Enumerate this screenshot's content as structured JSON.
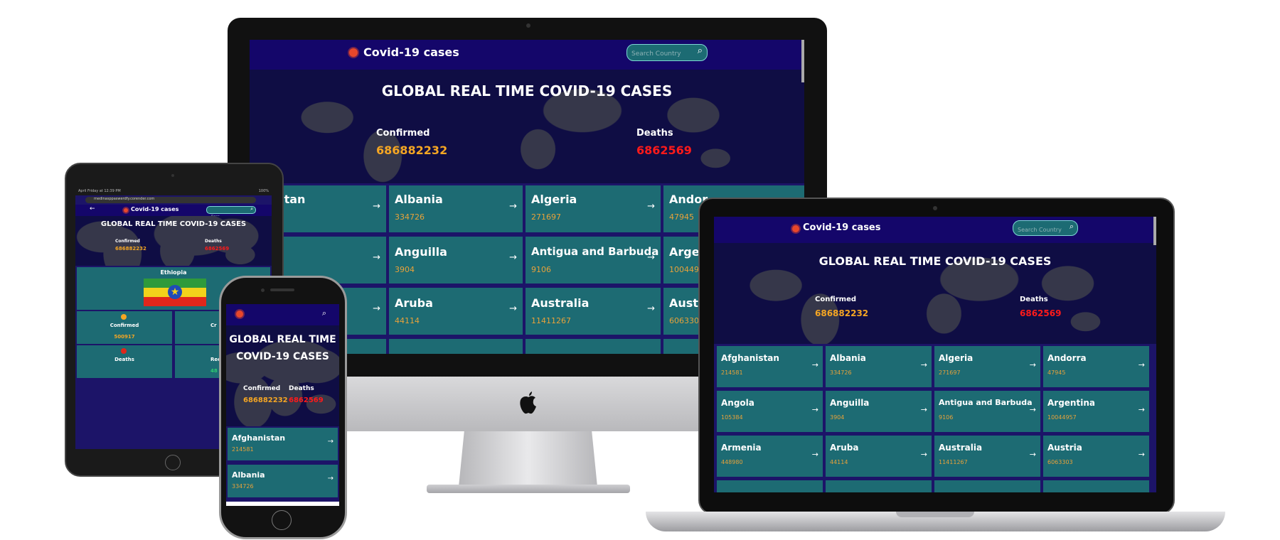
{
  "app": {
    "brand": "Covid-19 cases",
    "search_placeholder": "Search Country",
    "hero_title": "GLOBAL REAL TIME COVID-19 CASES",
    "phone_hero_title_line1": "GLOBAL REAL TIME",
    "phone_hero_title_line2": "COVID-19 CASES",
    "confirmed_label": "Confirmed",
    "deaths_label": "Deaths",
    "confirmed_value": "686882232",
    "deaths_value": "6862569",
    "arrow_glyph": "→",
    "search_glyph": "⌕",
    "icons": {
      "logo": "virus-logo-icon",
      "search": "search-icon",
      "arrow": "arrow-right-icon"
    },
    "colors": {
      "nav": "#14066a",
      "card": "#1d6b73",
      "confirmed": "#f5a623",
      "deaths": "#ff1a1a"
    }
  },
  "countries": [
    {
      "name": "Afghanistan",
      "value": "214581"
    },
    {
      "name": "Albania",
      "value": "334726"
    },
    {
      "name": "Algeria",
      "value": "271697"
    },
    {
      "name": "Andorra",
      "value": "47945"
    },
    {
      "name": "Angola",
      "value": "105384"
    },
    {
      "name": "Anguilla",
      "value": "3904"
    },
    {
      "name": "Antigua and Barbuda",
      "value": "9106"
    },
    {
      "name": "Argentina",
      "value": "10044957"
    },
    {
      "name": "Armenia",
      "value": "448980"
    },
    {
      "name": "Aruba",
      "value": "44114"
    },
    {
      "name": "Australia",
      "value": "11411267"
    },
    {
      "name": "Austria",
      "value": "6063303"
    }
  ],
  "imac_visible": {
    "row1": [
      {
        "name": "hanistan"
      },
      {
        "name": "Albania",
        "value": "334726"
      },
      {
        "name": "Algeria",
        "value": "271697"
      },
      {
        "name": "Andor",
        "value": "47945"
      }
    ],
    "row2": [
      {
        "name": "ola"
      },
      {
        "name": "Anguilla",
        "value": "3904"
      },
      {
        "name": "Antigua and Barbuda",
        "value": "9106"
      },
      {
        "name": "Arge",
        "value": "1004495"
      }
    ],
    "row3": [
      {
        "name": "Aruba",
        "value": "44114"
      },
      {
        "name": "Australia",
        "value": "11411267"
      },
      {
        "name": "Austr",
        "value": "606330"
      }
    ]
  },
  "tablet": {
    "status_left": "April Friday at 12:39 PM",
    "status_right": "100%",
    "url": "medinasppaswerdfy.corender.com",
    "search_placeholder": "Sear..",
    "country": "Ethiopia",
    "panel_confirmed": "Confirmed",
    "panel_confirmed_value": "500917",
    "panel_deaths": "Deaths",
    "panel_cr": "Cr",
    "panel_rec": "Rec",
    "panel_rec_value": "48"
  }
}
